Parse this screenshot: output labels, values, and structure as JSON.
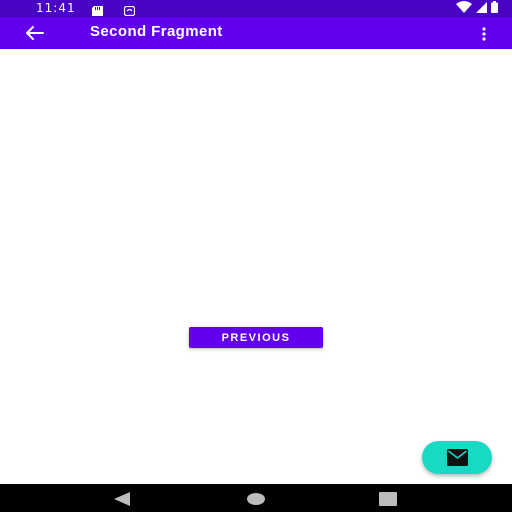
{
  "status_bar": {
    "time": "11:41",
    "icons": [
      "sd-card-icon",
      "notification-icon",
      "wifi-icon",
      "signal-icon",
      "battery-icon"
    ]
  },
  "app_bar": {
    "title": "Second Fragment",
    "back_icon": "arrow-back-icon",
    "menu_icon": "more-vert-icon"
  },
  "content": {
    "previous_button_label": "PREVIOUS"
  },
  "fab": {
    "icon": "email-icon"
  },
  "navigation_bar": {
    "icons": [
      "nav-back-icon",
      "nav-home-icon",
      "nav-recents-icon"
    ]
  },
  "colors": {
    "status_bar": "#4a05c4",
    "primary": "#6200ee",
    "accent": "#17d9c4",
    "navigation_bar": "#000000",
    "background": "#ffffff"
  }
}
